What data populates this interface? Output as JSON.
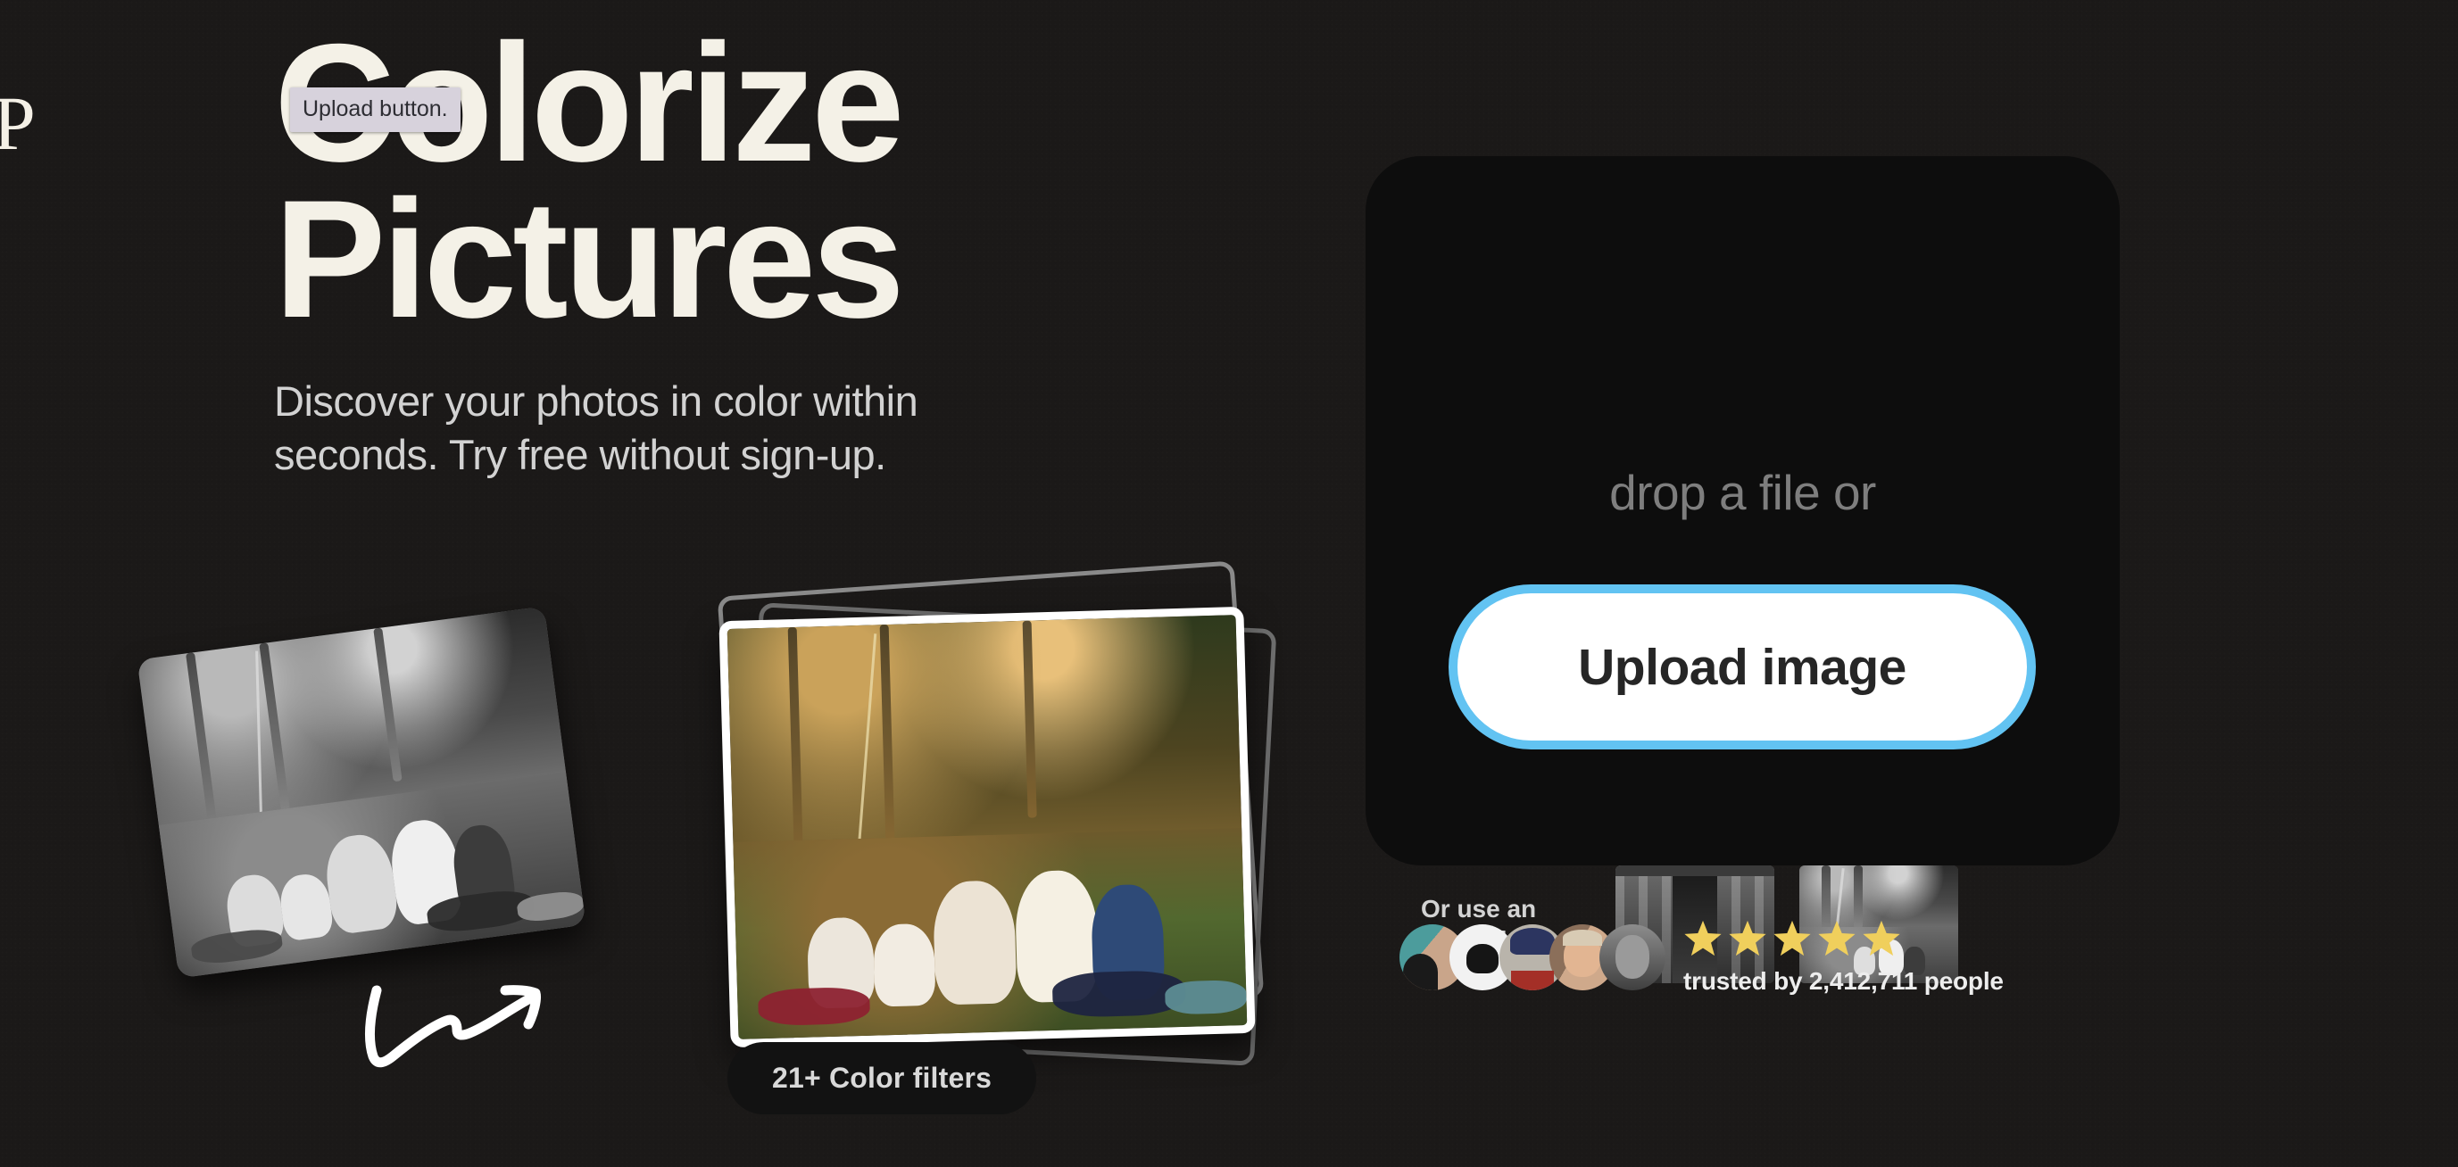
{
  "page": {
    "background_color": "#1b1918",
    "brand_mark": "P"
  },
  "tooltip": {
    "text": "Upload button.",
    "background_color": "#d7d2dc",
    "text_color": "#2d2d33"
  },
  "hero": {
    "title_line_1": "Colorize",
    "title_line_2": "Pictures",
    "title_color": "#f4f1e7",
    "subtitle": "Discover your photos in color within seconds. Try free without sign-up.",
    "subtitle_color": "#d2d2d2"
  },
  "showcase": {
    "before_image_alt": "black and white family picnic photo",
    "after_image_alt": "colorized family picnic photo",
    "arrow_icon": "hand-drawn-arrow-icon",
    "filters_badge": "21+ Color filters",
    "filters_badge_bg": "#121212",
    "filters_badge_color": "#d9d9d9"
  },
  "upload_card": {
    "background_color": "#0d0d0d",
    "drop_label": "drop a file or",
    "drop_label_color": "#7e7e7e",
    "upload_button_label": "Upload image",
    "upload_button_bg": "#ffffff",
    "upload_button_border_color": "#62c3f2",
    "upload_button_text_color": "#262626",
    "examples_label": "Or use an example",
    "examples": [
      {
        "alt": "vintage portrait of a woman in front of a folding screen"
      },
      {
        "alt": "black and white family picnic in the forest"
      }
    ]
  },
  "trust": {
    "avatars": [
      {
        "alt": "young man holding a dog"
      },
      {
        "alt": "person with a cap on white background"
      },
      {
        "alt": "child in a knitted beanie"
      },
      {
        "alt": "smiling blond man"
      },
      {
        "alt": "older bearded man in black and white"
      }
    ],
    "stars": 5,
    "star_color": "#f0cf5c",
    "trusted_text": "trusted by 2,412,711 people",
    "trusted_text_color": "#ededed"
  }
}
